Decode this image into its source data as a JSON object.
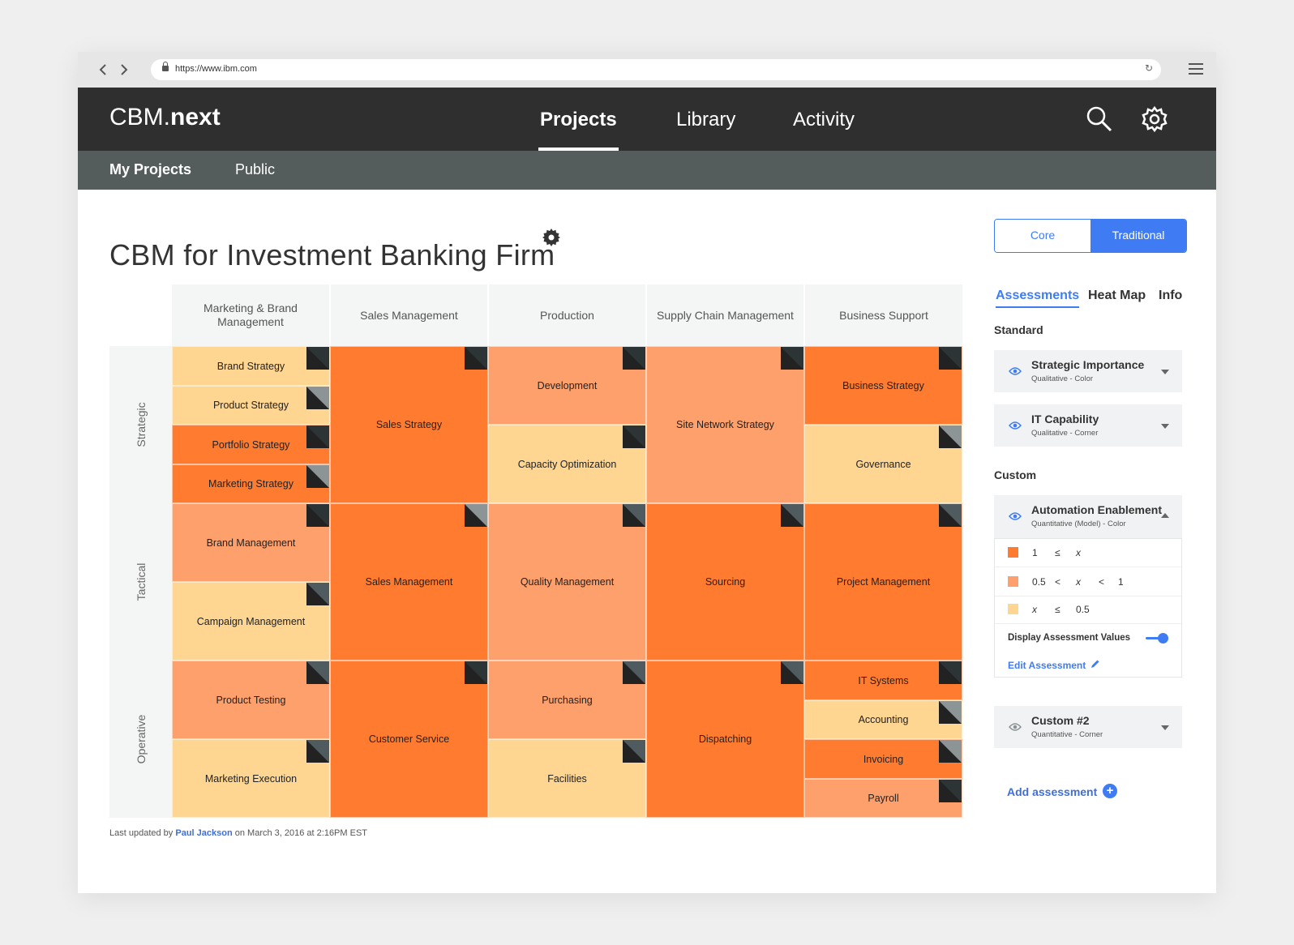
{
  "browser": {
    "url": "https://www.ibm.com",
    "back_icon": "chevron-left-icon",
    "forward_icon": "chevron-right-icon",
    "reload_glyph": "↻",
    "menu_icon": "hamburger-icon"
  },
  "header": {
    "brand_regular": "CBM.",
    "brand_bold": "next",
    "tabs": [
      {
        "label": "Projects",
        "active": true
      },
      {
        "label": "Library",
        "active": false
      },
      {
        "label": "Activity",
        "active": false
      }
    ]
  },
  "subnav": {
    "tabs": [
      {
        "label": "My Projects",
        "active": true
      },
      {
        "label": "Public",
        "active": false
      }
    ]
  },
  "page": {
    "title": "CBM for Investment Banking Firm",
    "view_toggle": {
      "options": [
        "Core",
        "Traditional"
      ],
      "selected": "Traditional"
    }
  },
  "map": {
    "columns": [
      "Marketing & Brand Management",
      "Sales Management",
      "Production",
      "Supply Chain Management",
      "Business Support"
    ],
    "rows": [
      "Strategic",
      "Tactical",
      "Operative"
    ],
    "colors": {
      "dark": "#ff7b2f",
      "mid": "#fda06c",
      "light": "#fed591",
      "corner_dark": "#2d3436",
      "corner_gray": "#8c9496",
      "corner_slate": "#4f5b5e"
    },
    "cells": [
      {
        "label": "Brand Strategy",
        "col": 0,
        "row": 0,
        "level": "light",
        "corner": "dark"
      },
      {
        "label": "Product Strategy",
        "col": 0,
        "row": 0,
        "level": "light",
        "corner": "gray"
      },
      {
        "label": "Portfolio Strategy",
        "col": 0,
        "row": 0,
        "level": "dark",
        "corner": "dark"
      },
      {
        "label": "Marketing Strategy",
        "col": 0,
        "row": 0,
        "level": "dark",
        "corner": "gray"
      },
      {
        "label": "Sales Strategy",
        "col": 1,
        "row": 0,
        "level": "dark",
        "corner": "dark"
      },
      {
        "label": "Development",
        "col": 2,
        "row": 0,
        "level": "mid",
        "corner": "dark"
      },
      {
        "label": "Capacity Optimization",
        "col": 2,
        "row": 0,
        "level": "light",
        "corner": "dark"
      },
      {
        "label": "Site Network Strategy",
        "col": 3,
        "row": 0,
        "level": "mid",
        "corner": "dark"
      },
      {
        "label": "Business Strategy",
        "col": 4,
        "row": 0,
        "level": "dark",
        "corner": "dark"
      },
      {
        "label": "Governance",
        "col": 4,
        "row": 0,
        "level": "light",
        "corner": "gray"
      },
      {
        "label": "Brand Management",
        "col": 0,
        "row": 1,
        "level": "mid",
        "corner": "dark"
      },
      {
        "label": "Campaign Management",
        "col": 0,
        "row": 1,
        "level": "light",
        "corner": "slate"
      },
      {
        "label": "Sales Management",
        "col": 1,
        "row": 1,
        "level": "dark",
        "corner": "gray"
      },
      {
        "label": "Quality Management",
        "col": 2,
        "row": 1,
        "level": "mid",
        "corner": "slate"
      },
      {
        "label": "Sourcing",
        "col": 3,
        "row": 1,
        "level": "dark",
        "corner": "slate"
      },
      {
        "label": "Project Management",
        "col": 4,
        "row": 1,
        "level": "dark",
        "corner": "slate"
      },
      {
        "label": "Product Testing",
        "col": 0,
        "row": 2,
        "level": "mid",
        "corner": "slate"
      },
      {
        "label": "Marketing Execution",
        "col": 0,
        "row": 2,
        "level": "light",
        "corner": "slate"
      },
      {
        "label": "Customer Service",
        "col": 1,
        "row": 2,
        "level": "dark",
        "corner": "dark"
      },
      {
        "label": "Purchasing",
        "col": 2,
        "row": 2,
        "level": "mid",
        "corner": "slate"
      },
      {
        "label": "Facilities",
        "col": 2,
        "row": 2,
        "level": "light",
        "corner": "slate"
      },
      {
        "label": "Dispatching",
        "col": 3,
        "row": 2,
        "level": "dark",
        "corner": "slate"
      },
      {
        "label": "IT Systems",
        "col": 4,
        "row": 2,
        "level": "dark",
        "corner": "dark"
      },
      {
        "label": "Accounting",
        "col": 4,
        "row": 2,
        "level": "light",
        "corner": "gray"
      },
      {
        "label": "Invoicing",
        "col": 4,
        "row": 2,
        "level": "dark",
        "corner": "gray"
      },
      {
        "label": "Payroll",
        "col": 4,
        "row": 2,
        "level": "mid",
        "corner": "dark"
      }
    ]
  },
  "footer": {
    "prefix": "Last updated by",
    "user": "Paul Jackson",
    "suffix": "on March 3, 2016 at 2:16PM EST"
  },
  "panel": {
    "tabs": [
      {
        "label": "Assessments",
        "active": true
      },
      {
        "label": "Heat Map",
        "active": false
      },
      {
        "label": "Info",
        "active": false
      }
    ],
    "standard_label": "Standard",
    "custom_label": "Custom",
    "standard": [
      {
        "name": "Strategic Importance",
        "sub": "Qualitative - Color"
      },
      {
        "name": "IT Capability",
        "sub": "Qualitative - Corner"
      }
    ],
    "custom_open": {
      "name": "Automation Enablement",
      "sub": "Quantitative (Model) - Color",
      "legend": [
        {
          "color": "#ff7b2f",
          "parts": [
            "1",
            "≤",
            "x"
          ]
        },
        {
          "color": "#fda06c",
          "parts": [
            "0.5",
            "<",
            "x",
            "<",
            "1"
          ]
        },
        {
          "color": "#fed591",
          "parts": [
            "x",
            "≤",
            "0.5"
          ]
        }
      ],
      "toggle_label": "Display Assessment Values",
      "toggle_on": true,
      "edit_label": "Edit Assessment"
    },
    "custom_closed": {
      "name": "Custom #2",
      "sub": "Quantitative - Corner"
    },
    "add_label": "Add assessment"
  }
}
